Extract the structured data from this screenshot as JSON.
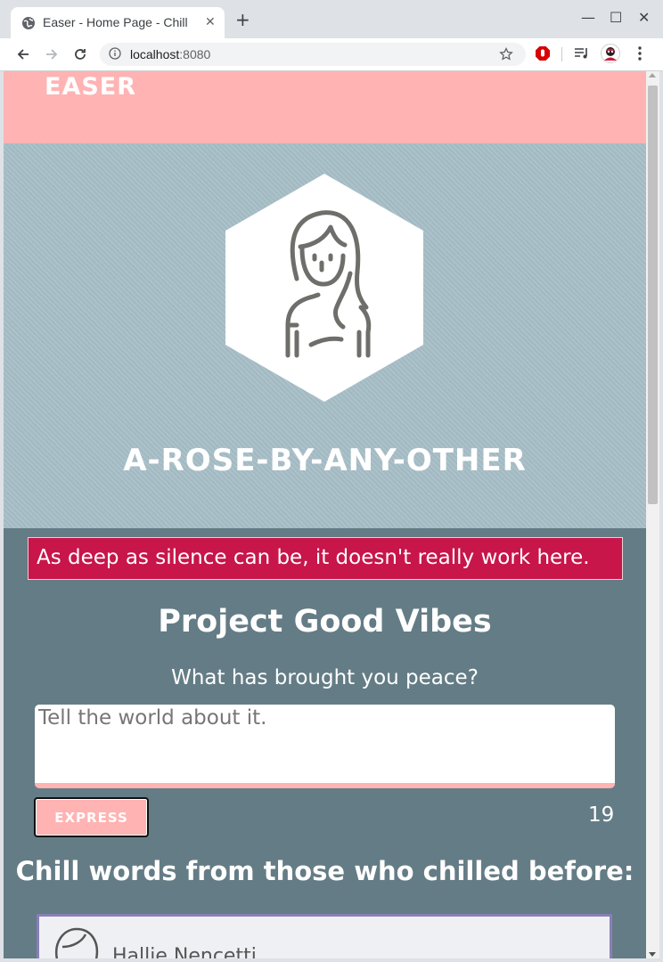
{
  "browser": {
    "tab_title": "Easer - Home Page - Chill",
    "tab_close": "✕",
    "new_tab": "+",
    "url_host": "localhost",
    "url_port": ":8080",
    "window_controls": {
      "minimize": "—",
      "maximize": "☐",
      "close": "✕"
    }
  },
  "page": {
    "brand": "EASER",
    "username": "A-ROSE-BY-ANY-OTHER",
    "alert": "As deep as silence can be, it doesn't really work here.",
    "section_title": "Project Good Vibes",
    "prompt": "What has brought you peace?",
    "entry_placeholder": "Tell the world about it.",
    "express_label": "EXPRESS",
    "char_counter": "19",
    "feed_title": "Chill words from those who chilled before:",
    "feed": [
      {
        "name": "Hallie Nencetti"
      }
    ]
  },
  "colors": {
    "header_pink": "#ffb3b3",
    "hero_blue": "#a8bfc8",
    "body_slate": "#647c85",
    "alert_red": "#c8154a",
    "card_border": "#8a7fb8"
  }
}
